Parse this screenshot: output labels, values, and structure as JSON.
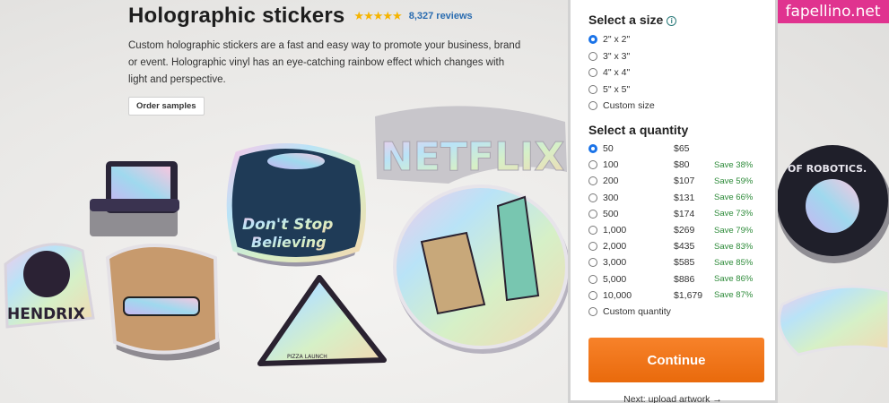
{
  "product": {
    "title": "Holographic stickers",
    "stars": "★★★★★",
    "reviews": "8,327 reviews",
    "description": "Custom holographic stickers are a fast and easy way to promote your business, brand or event. Holographic vinyl has an eye-catching rainbow effect which changes with light and perspective.",
    "order_samples": "Order samples"
  },
  "stickers": {
    "dont_stop": "Don't Stop",
    "believing": "Believing",
    "netflix": "NETFLIX",
    "hendrix": "HENDRIX",
    "pizza": "PIZZA LAUNCH",
    "robotics": "OF ROBOTICS."
  },
  "watermark": "fapellino.net",
  "size": {
    "title": "Select a size",
    "info_icon": "info-icon",
    "options": [
      "2\" x 2\"",
      "3\" x 3\"",
      "4\" x 4\"",
      "5\" x 5\"",
      "Custom size"
    ],
    "selected": 0
  },
  "quantity": {
    "title": "Select a quantity",
    "options": [
      {
        "qty": "50",
        "price": "$65",
        "save": ""
      },
      {
        "qty": "100",
        "price": "$80",
        "save": "Save 38%"
      },
      {
        "qty": "200",
        "price": "$107",
        "save": "Save 59%"
      },
      {
        "qty": "300",
        "price": "$131",
        "save": "Save 66%"
      },
      {
        "qty": "500",
        "price": "$174",
        "save": "Save 73%"
      },
      {
        "qty": "1,000",
        "price": "$269",
        "save": "Save 79%"
      },
      {
        "qty": "2,000",
        "price": "$435",
        "save": "Save 83%"
      },
      {
        "qty": "3,000",
        "price": "$585",
        "save": "Save 85%"
      },
      {
        "qty": "5,000",
        "price": "$886",
        "save": "Save 86%"
      },
      {
        "qty": "10,000",
        "price": "$1,679",
        "save": "Save 87%"
      }
    ],
    "custom": "Custom quantity",
    "selected": 0
  },
  "continue_label": "Continue",
  "next_label": "Next: upload artwork →",
  "colors": {
    "accent": "#1a73e8",
    "continue": "#f07a1c",
    "save": "#2e8b3a",
    "watermark": "#e0338f"
  }
}
